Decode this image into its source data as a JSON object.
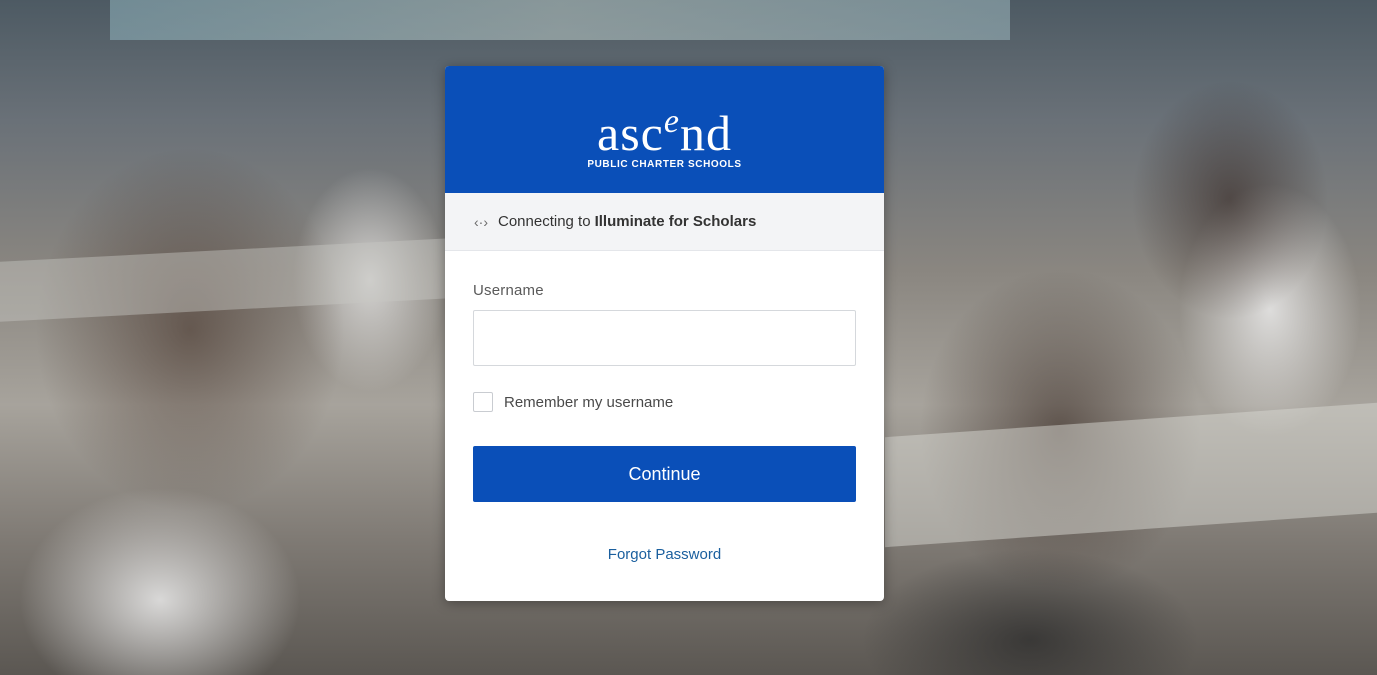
{
  "brand": {
    "logo_pre": "asc",
    "logo_sup": "e",
    "logo_post": "nd",
    "logo_tagline": "PUBLIC CHARTER SCHOOLS",
    "color": "#0a4fb8"
  },
  "connect": {
    "icon": "arrows-exchange-icon",
    "prefix": "Connecting to",
    "app_name": "Illuminate for Scholars"
  },
  "form": {
    "username_label": "Username",
    "username_value": "",
    "username_placeholder": "",
    "remember_label": "Remember my username",
    "remember_checked": false,
    "continue_label": "Continue",
    "forgot_label": "Forgot Password"
  }
}
